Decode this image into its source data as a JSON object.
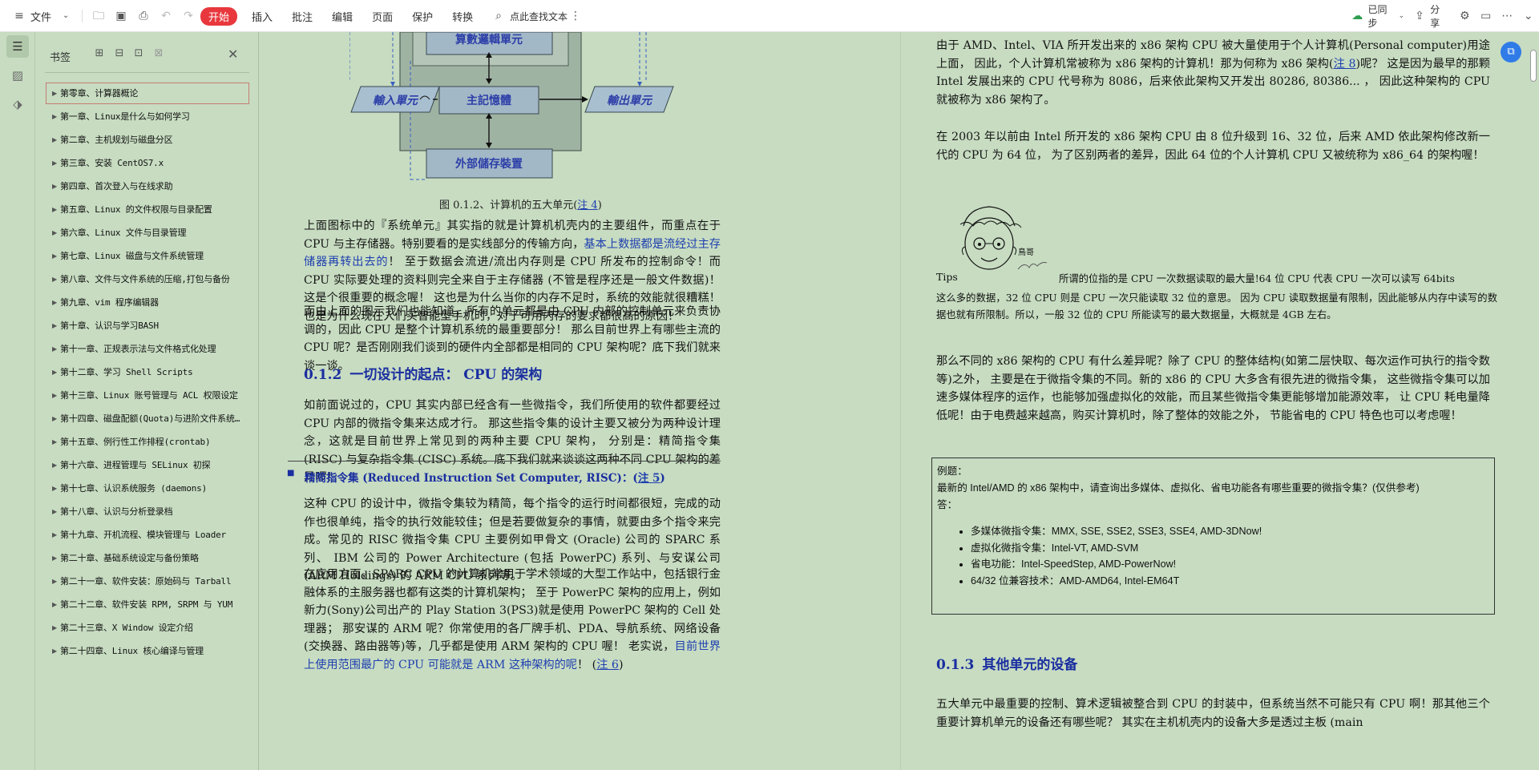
{
  "toolbar": {
    "file_menu": "文件",
    "tabs": [
      "开始",
      "插入",
      "批注",
      "编辑",
      "页面",
      "保护",
      "转换"
    ],
    "active_tab": "开始",
    "search_placeholder": "点此查找文本",
    "sync_label": "已同步",
    "share_label": "分享"
  },
  "bookmarks": {
    "title": "书签",
    "items": [
      "第零章、计算器概论",
      "第一章、Linux是什么与如何学习",
      "第二章、主机规划与磁盘分区",
      "第三章、安装 CentOS7.x",
      "第四章、首次登入与在线求助",
      "第五章、Linux 的文件权限与目录配置",
      "第六章、Linux 文件与目录管理",
      "第七章、Linux 磁盘与文件系统管理",
      "第八章、文件与文件系统的压缩,打包与备份",
      "第九章、vim 程序编辑器",
      "第十章、认识与学习BASH",
      "第十一章、正规表示法与文件格式化处理",
      "第十二章、学习 Shell Scripts",
      "第十三章、Linux 账号管理与 ACL 权限设定",
      "第十四章、磁盘配额(Quota)与进阶文件系统管理",
      "第十五章、例行性工作排程(crontab)",
      "第十六章、进程管理与 SELinux 初探",
      "第十七章、认识系统服务 (daemons)",
      "第十八章、认识与分析登录档",
      "第十九章、开机流程、模块管理与 Loader",
      "第二十章、基础系统设定与备份策略",
      "第二十一章、软件安装：原始码与 Tarball",
      "第二十二章、软件安装 RPM, SRPM 与 YUM",
      "第二十三章、X Window 设定介绍",
      "第二十四章、Linux 核心编译与管理"
    ]
  },
  "diagram": {
    "alu": "算數邏輯單元",
    "input": "輸入單元",
    "memory": "主記憶體",
    "output": "輸出單元",
    "storage": "外部儲存裝置",
    "caption_text": "图 0.1.2、计算机的五大单元(",
    "caption_link": "注 4",
    "caption_end": ")"
  },
  "left_page": {
    "p1_a": "上面图标中的『系统单元』其实指的就是计算机机壳内的主要组件，而重点在于 CPU 与主存储器。特别要看的是实线部分的传输方向，",
    "p1_blue": "基本上数据都是流经过主存储器再转出去的",
    "p1_b": "！ 至于数据会流进/流出内存则是 CPU 所发布的控制命令！而 CPU 实际要处理的资料则完全来自于主存储器 (不管是程序还是一般文件数据)！这是个很重要的概念喔！ 这也是为什么当你的内存不足时，系统的效能就很糟糕！也是为什么现在人们买智能型手机时，对于可用内存的要求都很高的原因！",
    "p2": "而由上面的图示我们也能知道，所有的单元都是由 CPU 内部的控制单元来负责协调的，因此 CPU 是整个计算机系统的最重要部分！ 那么目前世界上有哪些主流的 CPU 呢？是否刚刚我们谈到的硬件内全部都是相同的 CPU 架构呢？底下我们就来谈一谈。",
    "h2_num": "0.1.2",
    "h2_title": "一切设计的起点： CPU 的架构",
    "p3": "如前面说过的，CPU 其实内部已经含有一些微指令，我们所使用的软件都要经过 CPU 内部的微指令集来达成才行。 那这些指令集的设计主要又被分为两种设计理念，这就是目前世界上常见到的两种主要 CPU 架构， 分别是：精简指令集 (RISC) 与复杂指令集 (CISC) 系统。底下我们就来谈谈这两种不同 CPU 架构的差异啰！",
    "bullet_bold": "精简指令集",
    "bullet_rest": " (Reduced Instruction Set Computer, RISC)：(",
    "bullet_link": "注 5",
    "bullet_end": ")",
    "p4": "这种 CPU 的设计中，微指令集较为精简，每个指令的运行时间都很短，完成的动作也很单纯，指令的执行效能较佳；但是若要做复杂的事情，就要由多个指令来完成。常见的 RISC 微指令集 CPU 主要例如甲骨文 (Oracle) 公司的 SPARC 系列、 IBM 公司的 Power Architecture (包括 PowerPC) 系列、与安谋公司 (ARM Holdings) 的 ARM CPU 系列等。",
    "p5_a": "在应用方面，SPARC CPU 的计算机常用于学术领域的大型工作站中，包括银行金融体系的主服务器也都有这类的计算机架构； 至于 PowerPC 架构的应用上，例如新力(Sony)公司出产的 Play Station 3(PS3)就是使用 PowerPC 架构的 Cell 处理器； 那安谋的 ARM 呢？你常使用的各厂牌手机、PDA、导航系统、网络设备(交换器、路由器等)等，几乎都是使用 ARM 架构的 CPU 喔！ 老实说，",
    "p5_blue": "目前世界上使用范围最广的 CPU 可能就是 ARM 这种架构的呢",
    "p5_b": "！ (",
    "p5_link": "注 6",
    "p5_end": ")"
  },
  "right_page": {
    "p1_a": "由于 AMD、Intel、VIA 所开发出来的 x86 架构 CPU 被大量使用于个人计算机(Personal computer)用途上面， 因此，个人计算机常被称为 x86 架构的计算机！那为何称为 x86 架构(",
    "p1_link": "注 8",
    "p1_b": ")呢？ 这是因为最早的那颗 Intel 发展出来的 CPU 代号称为 8086，后来依此架构又开发出 80286, 80386... ， 因此这种架构的 CPU 就被称为 x86 架构了。",
    "p2": "在 2003 年以前由 Intel 所开发的 x86 架构 CPU 由 8 位升级到 16、32 位，后来 AMD 依此架构修改新一代的 CPU 为 64 位， 为了区别两者的差异，因此 64 位的个人计算机 CPU 又被统称为 x86_64 的架构喔！",
    "tips_label": "Tips",
    "tips_sig": "鳥哥",
    "tips_line1": "所谓的位指的是 CPU 一次数据读取的最大量!64 位 CPU 代表 CPU 一次可以读写 64bits",
    "tips_rest": "这么多的数据，32 位 CPU 则是 CPU 一次只能读取 32 位的意思。 因为 CPU 读取数据量有限制，因此能够从内存中读写的数据也就有所限制。所以，一般 32 位的 CPU 所能读写的最大数据量，大概就是 4GB 左右。",
    "p3": "那么不同的 x86 架构的 CPU 有什么差异呢？除了 CPU 的整体结构(如第二层快取、每次运作可执行的指令数等)之外， 主要是在于微指令集的不同。新的 x86 的 CPU 大多含有很先进的微指令集， 这些微指令集可以加速多媒体程序的运作，也能够加强虚拟化的效能，而且某些微指令集更能够增加能源效率， 让 CPU 耗电量降低呢！由于电费越来越高，购买计算机时，除了整体的效能之外， 节能省电的 CPU 特色也可以考虑喔！",
    "example": {
      "label": "例题：",
      "question": "最新的 Intel/AMD 的 x86 架构中，请查询出多媒体、虚拟化、省电功能各有哪些重要的微指令集？(仅供参考)",
      "answer_label": "答：",
      "items": [
        "多媒体微指令集：MMX, SSE, SSE2, SSE3, SSE4, AMD-3DNow!",
        "虚拟化微指令集：Intel-VT, AMD-SVM",
        "省电功能：Intel-SpeedStep, AMD-PowerNow!",
        "64/32 位兼容技术：AMD-AMD64, Intel-EM64T"
      ]
    },
    "h2_num": "0.1.3",
    "h2_title": "其他单元的设备",
    "p4": "五大单元中最重要的控制、算术逻辑被整合到 CPU 的封装中，但系统当然不可能只有 CPU 啊！那其他三个重要计算机单元的设备还有哪些呢？ 其实在主机机壳内的设备大多是透过主板 (main"
  }
}
